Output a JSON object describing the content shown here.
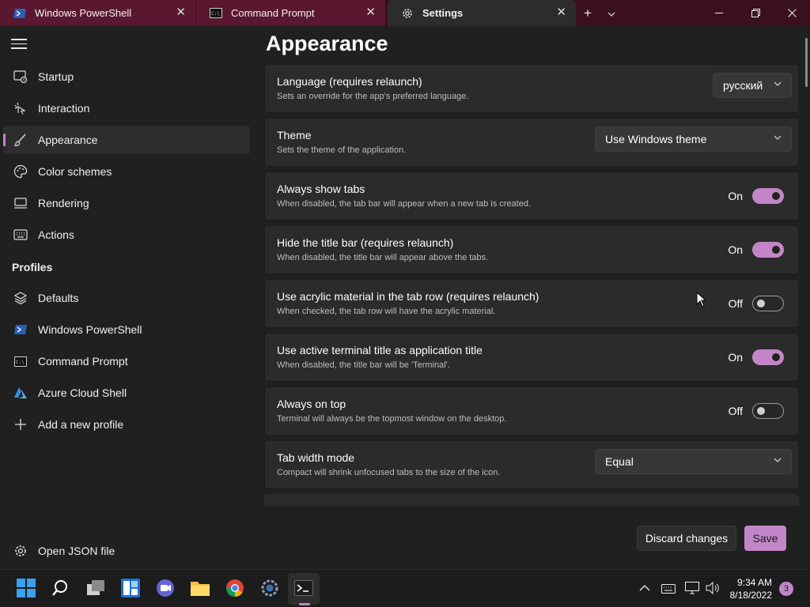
{
  "tabs": [
    {
      "label": "Windows PowerShell",
      "icon": "powershell-icon"
    },
    {
      "label": "Command Prompt",
      "icon": "cmd-icon"
    },
    {
      "label": "Settings",
      "icon": "gear-icon"
    }
  ],
  "tab_actions": {
    "new_tab": "+",
    "dropdown": "⌄"
  },
  "sidebar": {
    "items": [
      {
        "label": "Startup",
        "icon": "startup-icon"
      },
      {
        "label": "Interaction",
        "icon": "interaction-icon"
      },
      {
        "label": "Appearance",
        "icon": "brush-icon"
      },
      {
        "label": "Color schemes",
        "icon": "palette-icon"
      },
      {
        "label": "Rendering",
        "icon": "monitor-icon"
      },
      {
        "label": "Actions",
        "icon": "keyboard-icon"
      }
    ],
    "profiles_header": "Profiles",
    "profiles": [
      {
        "label": "Defaults",
        "icon": "layers-icon"
      },
      {
        "label": "Windows PowerShell",
        "icon": "powershell-icon"
      },
      {
        "label": "Command Prompt",
        "icon": "cmd-icon"
      },
      {
        "label": "Azure Cloud Shell",
        "icon": "azure-icon"
      },
      {
        "label": "Add a new profile",
        "icon": "plus-icon"
      }
    ],
    "open_json": "Open JSON file"
  },
  "main": {
    "title": "Appearance",
    "settings": [
      {
        "title": "Language (requires relaunch)",
        "desc": "Sets an override for the app's preferred language.",
        "type": "dropdown",
        "value": "русский"
      },
      {
        "title": "Theme",
        "desc": "Sets the theme of the application.",
        "type": "dropdown",
        "value": "Use Windows theme"
      },
      {
        "title": "Always show tabs",
        "desc": "When disabled, the tab bar will appear when a new tab is created.",
        "type": "toggle",
        "value": "On"
      },
      {
        "title": "Hide the title bar (requires relaunch)",
        "desc": "When disabled, the title bar will appear above the tabs.",
        "type": "toggle",
        "value": "On"
      },
      {
        "title": "Use acrylic material in the tab row (requires relaunch)",
        "desc": "When checked, the tab row will have the acrylic material.",
        "type": "toggle",
        "value": "Off"
      },
      {
        "title": "Use active terminal title as application title",
        "desc": "When disabled, the title bar will be 'Terminal'.",
        "type": "toggle",
        "value": "On"
      },
      {
        "title": "Always on top",
        "desc": "Terminal will always be the topmost window on the desktop.",
        "type": "toggle",
        "value": "Off"
      },
      {
        "title": "Tab width mode",
        "desc": "Compact will shrink unfocused tabs to the size of the icon.",
        "type": "dropdown",
        "value": "Equal"
      }
    ],
    "discard_label": "Discard changes",
    "save_label": "Save"
  },
  "taskbar": {
    "time": "9:34 AM",
    "date": "8/18/2022",
    "notification_count": "3",
    "apps": [
      "windows-start-icon",
      "search-icon",
      "task-view-icon",
      "widgets-icon",
      "teams-chat-icon",
      "file-explorer-icon",
      "chrome-icon",
      "settings-icon",
      "terminal-icon"
    ]
  },
  "colors": {
    "accent": "#c286c8",
    "tab_bar": "#3a0f1e",
    "background": "#202020",
    "card": "#2b2b2b"
  }
}
